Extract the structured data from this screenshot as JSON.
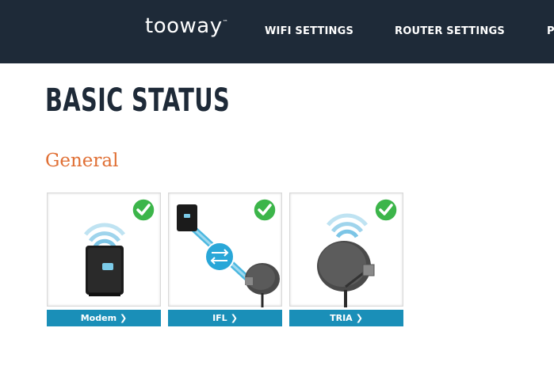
{
  "header": {
    "logo": "tooway",
    "logo_tm": "™",
    "nav": [
      {
        "label": "WIFI SETTINGS"
      },
      {
        "label": "ROUTER SETTINGS"
      },
      {
        "label": "P"
      }
    ]
  },
  "page": {
    "title": "BASIC STATUS",
    "section": "General"
  },
  "cards": [
    {
      "label": "Modem",
      "icon": "modem-icon",
      "status": "ok"
    },
    {
      "label": "IFL",
      "icon": "ifl-link-icon",
      "status": "ok"
    },
    {
      "label": "TRIA",
      "icon": "satellite-dish-icon",
      "status": "ok"
    }
  ],
  "colors": {
    "header_bg": "#1e2a38",
    "accent_orange": "#e06f34",
    "button_blue": "#1a8fb8",
    "status_green": "#3cb54a"
  }
}
